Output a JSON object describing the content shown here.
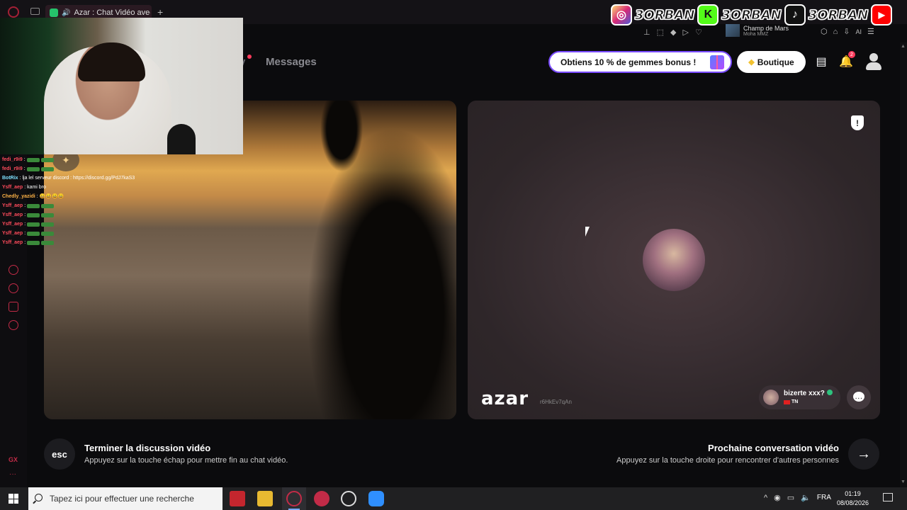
{
  "browser": {
    "tab_title": "Azar : Chat Vidéo avec d",
    "new_tab": "+"
  },
  "social_banner": [
    {
      "icon": "instagram-icon",
      "label": "3ORBAN",
      "color": "#d62976"
    },
    {
      "icon": "kick-icon",
      "label": "3ORBAN",
      "color": "#53fc18"
    },
    {
      "icon": "tiktok-icon",
      "label": "3ORBAN",
      "color": "#111111"
    },
    {
      "icon": "youtube-icon",
      "label": "3ORBAN",
      "color": "#ff0000"
    }
  ],
  "mini_player": {
    "title": "Champ de Mars",
    "artist": "Moha MMZ"
  },
  "toolbar3": {
    "ai": "AI"
  },
  "nav": {
    "partial": "y",
    "messages": "Messages"
  },
  "header": {
    "promo": "Obtiens 10 % de gemmes bonus !",
    "shop": "Boutique",
    "notification_count": "2"
  },
  "chat": [
    {
      "user": "fedi_r9i9",
      "msg": ":",
      "color": "#ff4b5c",
      "emote": true
    },
    {
      "user": "fedi_r9i9",
      "msg": ":",
      "color": "#ff4b5c",
      "emote": true
    },
    {
      "user": "BotRix",
      "msg": ": lja lel serveur discord : https://discord.gg/PdJ7kaS3",
      "color": "#7ee0ff",
      "emote": false
    },
    {
      "user": "Ysff_aep",
      "msg": ": kami bro",
      "color": "#ff4b5c",
      "emote": false
    },
    {
      "user": "Chedly_yazidi",
      "msg": ": 😀😀😀😀",
      "color": "#ffb347",
      "emote": false
    },
    {
      "user": "Ysff_aep",
      "msg": ":",
      "color": "#ff4b5c",
      "emote": true
    },
    {
      "user": "Ysff_aep",
      "msg": ":",
      "color": "#ff4b5c",
      "emote": true
    },
    {
      "user": "Ysff_aep",
      "msg": ":",
      "color": "#ff4b5c",
      "emote": true
    },
    {
      "user": "Ysff_aep",
      "msg": ":",
      "color": "#ff4b5c",
      "emote": true
    },
    {
      "user": "Ysff_aep",
      "msg": ":",
      "color": "#ff4b5c",
      "emote": true
    }
  ],
  "peer": {
    "logo": "azar",
    "session_id": "r6HkEv7qAn",
    "name": "bizerte xxx?",
    "country": "TN"
  },
  "controls": {
    "esc_label": "esc",
    "end_title": "Terminer la discussion vidéo",
    "end_sub": "Appuyez sur la touche échap pour mettre fin au chat vidéo.",
    "next_title": "Prochaine conversation vidéo",
    "next_sub": "Appuyez sur la touche droite pour rencontrer d'autres personnes",
    "next_arrow": "→"
  },
  "taskbar": {
    "search_placeholder": "Tapez ici pour effectuer une recherche",
    "lang": "FRA",
    "time": "01:19",
    "date": "08/08/2026"
  },
  "sidebar": {
    "gx": "GX",
    "more": "···"
  }
}
